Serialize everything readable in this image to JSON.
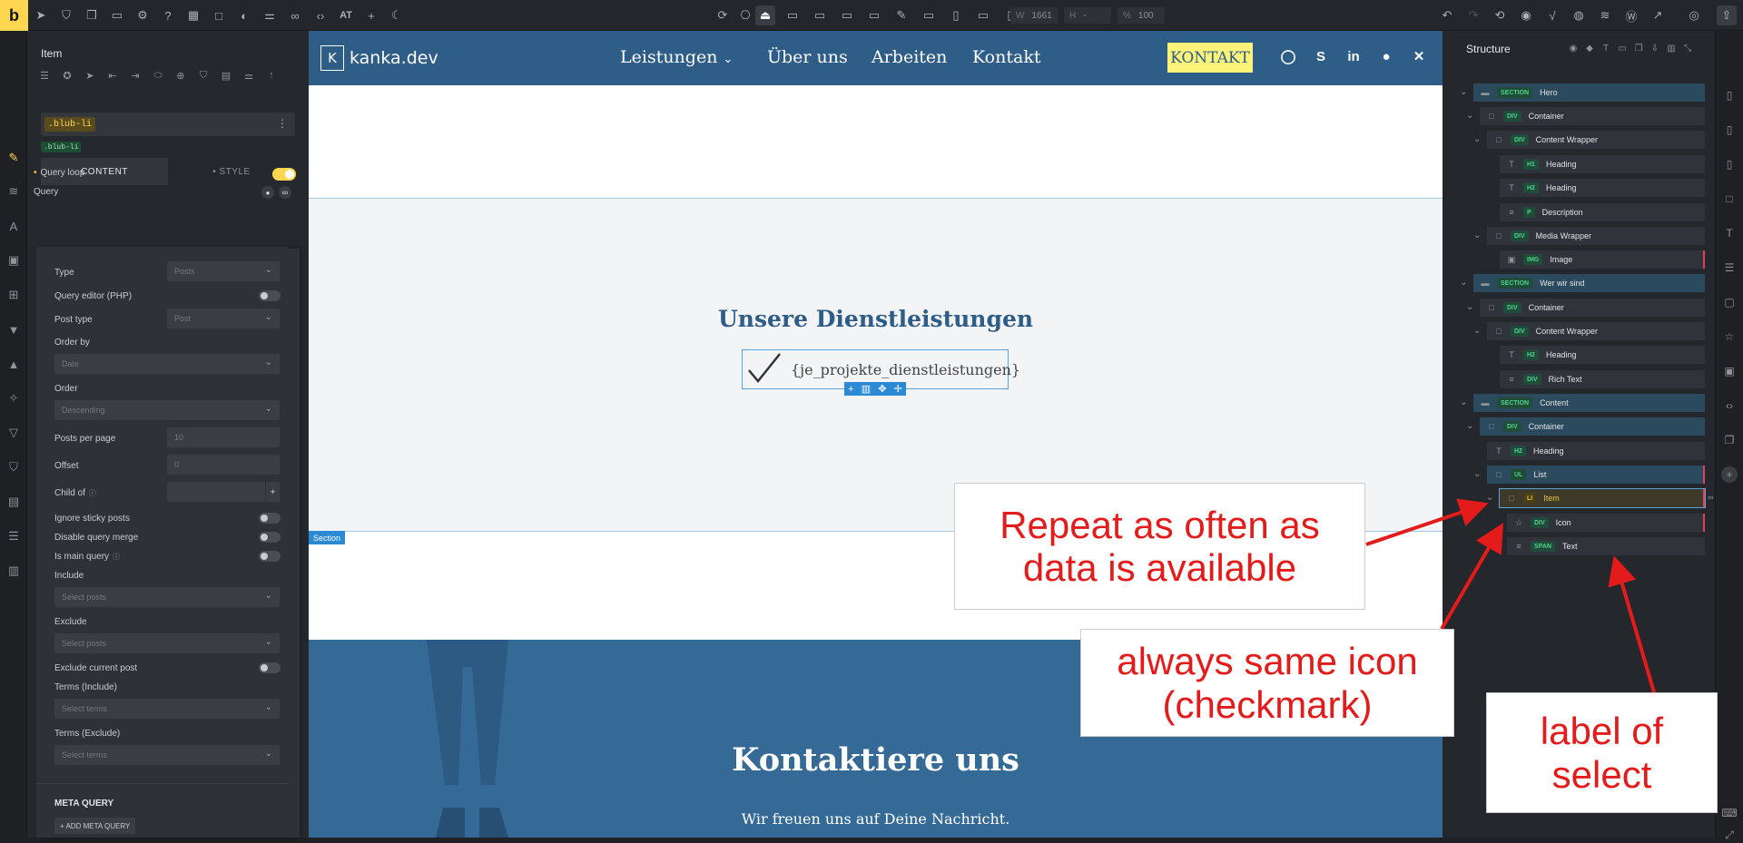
{
  "toolbar": {
    "logo": "b",
    "text_tool": "AT",
    "width_label": "W",
    "width_value": "1661",
    "height_label": "H",
    "height_value": "-",
    "zoom_label": "%",
    "zoom_value": "100"
  },
  "left_panel": {
    "title": "Item",
    "class_chip": ".blub-li",
    "class_chip_small": ".blub-li",
    "tab_content": "CONTENT",
    "tab_style": "• STYLE",
    "query_loop_label": "Query loop",
    "query_label": "Query",
    "popup": {
      "type_label": "Type",
      "type_value": "Posts",
      "query_editor_label": "Query editor (PHP)",
      "post_type_label": "Post type",
      "post_type_value": "Post",
      "order_by_label": "Order by",
      "order_by_value": "Date",
      "order_label": "Order",
      "order_value": "Descending",
      "posts_per_page_label": "Posts per page",
      "posts_per_page_placeholder": "10",
      "offset_label": "Offset",
      "offset_placeholder": "0",
      "child_of_label": "Child of",
      "ignore_sticky_label": "Ignore sticky posts",
      "disable_merge_label": "Disable query merge",
      "is_main_label": "Is main query",
      "include_label": "Include",
      "include_placeholder": "Select posts",
      "exclude_label": "Exclude",
      "exclude_placeholder": "Select posts",
      "exclude_current_label": "Exclude current post",
      "terms_include_label": "Terms (Include)",
      "terms_include_placeholder": "Select terms",
      "terms_exclude_label": "Terms (Exclude)",
      "terms_exclude_placeholder": "Select terms",
      "meta_query_heading": "META QUERY",
      "add_meta_query": "+ ADD META QUERY"
    }
  },
  "site": {
    "brand": "kanka.dev",
    "brand_mark": "K",
    "nav": [
      "Leistungen",
      "Über uns",
      "Arbeiten",
      "Kontakt"
    ],
    "cta": "KONTAKT",
    "services_title": "Unsere Dienstleistungen",
    "service_item_text": "{je_projekte_dienstleistungen}",
    "section_tag": "Section",
    "contact_title": "Kontaktiere uns",
    "contact_sub": "Wir freuen uns auf Deine Nachricht."
  },
  "structure": {
    "title": "Structure",
    "nodes": [
      {
        "tag": "SECTION",
        "label": "Hero"
      },
      {
        "tag": "DIV",
        "label": "Container"
      },
      {
        "tag": "DIV",
        "label": "Content Wrapper"
      },
      {
        "tag": "H1",
        "label": "Heading"
      },
      {
        "tag": "H2",
        "label": "Heading"
      },
      {
        "tag": "P",
        "label": "Description"
      },
      {
        "tag": "DIV",
        "label": "Media Wrapper"
      },
      {
        "tag": "IMG",
        "label": "Image"
      },
      {
        "tag": "SECTION",
        "label": "Wer wir sind"
      },
      {
        "tag": "DIV",
        "label": "Container"
      },
      {
        "tag": "DIV",
        "label": "Content Wrapper"
      },
      {
        "tag": "H2",
        "label": "Heading"
      },
      {
        "tag": "DIV",
        "label": "Rich Text"
      },
      {
        "tag": "SECTION",
        "label": "Content"
      },
      {
        "tag": "DIV",
        "label": "Container"
      },
      {
        "tag": "H2",
        "label": "Heading"
      },
      {
        "tag": "UL",
        "label": "List"
      },
      {
        "tag": "LI",
        "label": "Item"
      },
      {
        "tag": "DIV",
        "label": "Icon"
      },
      {
        "tag": "SPAN",
        "label": "Text"
      }
    ]
  },
  "annotations": {
    "repeat": "Repeat as often as data is available",
    "icon": "always same icon (checkmark)",
    "label": "label of select"
  },
  "colors": {
    "accent": "#ffd64f",
    "nav_bg": "#2e5d87",
    "selection": "#2b8ad3",
    "annotation": "#e31b1b"
  }
}
